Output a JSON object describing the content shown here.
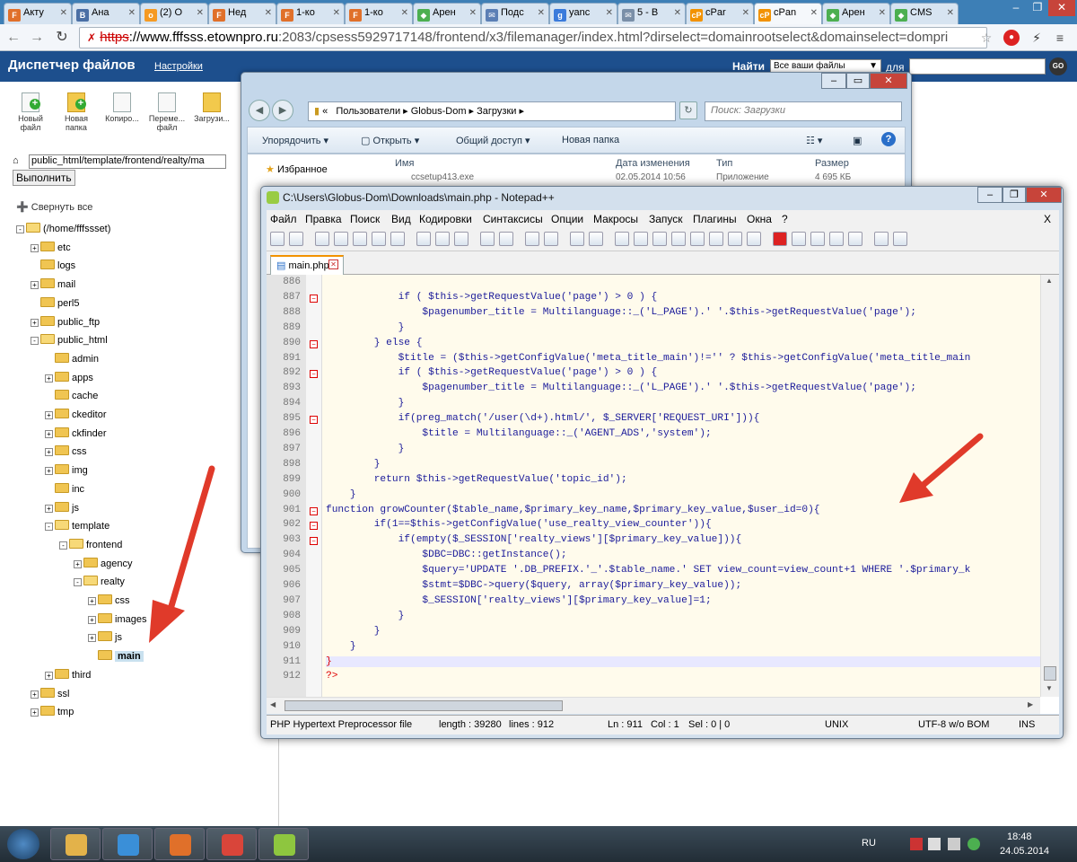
{
  "browser": {
    "tabs": [
      {
        "label": "Акту",
        "fav_text": "F",
        "fav_color": "#e0702a"
      },
      {
        "label": "Ана",
        "fav_text": "B",
        "fav_color": "#4a6fa5"
      },
      {
        "label": "(2) О",
        "fav_text": "о",
        "fav_color": "#f59a23"
      },
      {
        "label": "Нед",
        "fav_text": "F",
        "fav_color": "#e0702a"
      },
      {
        "label": "1-ко",
        "fav_text": "F",
        "fav_color": "#e0702a"
      },
      {
        "label": "1-ко",
        "fav_text": "F",
        "fav_color": "#e0702a"
      },
      {
        "label": "Арен",
        "fav_text": "◆",
        "fav_color": "#4caf50"
      },
      {
        "label": "Подс",
        "fav_text": "✉",
        "fav_color": "#5b7fb5"
      },
      {
        "label": "yanc",
        "fav_text": "g",
        "fav_color": "#3b7bdb"
      },
      {
        "label": "5 - В",
        "fav_text": "✉",
        "fav_color": "#7a8fa8"
      },
      {
        "label": "cPar",
        "fav_text": "cP",
        "fav_color": "#f29200"
      },
      {
        "label": "cPan",
        "fav_text": "cP",
        "fav_color": "#f29200"
      },
      {
        "label": "Арен",
        "fav_text": "◆",
        "fav_color": "#4caf50"
      },
      {
        "label": "CMS",
        "fav_text": "◆",
        "fav_color": "#4caf50"
      }
    ],
    "url_scheme": "https",
    "url_host": "://www.fffsss.etownpro.ru",
    "url_path": ":2083/cpsess5929717148/frontend/x3/filemanager/index.html?dirselect=domainrootselect&domainselect=dompri"
  },
  "cpanel": {
    "title": "Диспетчер файлов",
    "settings_link": "Настройки",
    "find_label": "Найти",
    "find_scope": "Все ваши файлы",
    "for_label": "для",
    "go_label": "GO",
    "tools": [
      {
        "label": "Новый файл",
        "icon": "new-file-icon"
      },
      {
        "label": "Новая папка",
        "icon": "new-folder-icon"
      },
      {
        "label": "Копиро...",
        "icon": "copy-icon"
      },
      {
        "label": "Переме... файл",
        "icon": "move-icon"
      },
      {
        "label": "Загрузи...",
        "icon": "upload-icon"
      }
    ],
    "path_value": "public_html/template/frontend/realty/ma",
    "go_button": "Выполнить",
    "collapse_all": "Свернуть все",
    "tree": [
      {
        "label": "(/home/fffssset)"
      },
      {
        "label": "etc"
      },
      {
        "label": "logs"
      },
      {
        "label": "mail"
      },
      {
        "label": "perl5"
      },
      {
        "label": "public_ftp"
      },
      {
        "label": "public_html"
      },
      {
        "label": "admin"
      },
      {
        "label": "apps"
      },
      {
        "label": "cache"
      },
      {
        "label": "ckeditor"
      },
      {
        "label": "ckfinder"
      },
      {
        "label": "css"
      },
      {
        "label": "img"
      },
      {
        "label": "inc"
      },
      {
        "label": "js"
      },
      {
        "label": "template"
      },
      {
        "label": "frontend"
      },
      {
        "label": "agency"
      },
      {
        "label": "realty"
      },
      {
        "label": "css"
      },
      {
        "label": "images"
      },
      {
        "label": "js"
      },
      {
        "label": "main"
      },
      {
        "label": "third"
      },
      {
        "label": "ssl"
      },
      {
        "label": "tmp"
      }
    ]
  },
  "explorer": {
    "breadcrumb": [
      "«",
      "Пользователи",
      "Globus-Dom",
      "Загрузки"
    ],
    "search_placeholder": "Поиск: Загрузки",
    "commands": [
      "Упорядочить",
      "Открыть",
      "Общий доступ",
      "Новая папка"
    ],
    "favorites": "Избранное",
    "columns": [
      "Имя",
      "Дата изменения",
      "Тип",
      "Размер"
    ],
    "first_row": [
      "ccsetup413.exe",
      "02.05.2014 10:56",
      "Приложение",
      "4 695 КБ"
    ]
  },
  "notepad": {
    "title": "C:\\Users\\Globus-Dom\\Downloads\\main.php - Notepad++",
    "menu": [
      "Файл",
      "Правка",
      "Поиск",
      "Вид",
      "Кодировки",
      "Синтаксисы",
      "Опции",
      "Макросы",
      "Запуск",
      "Плагины",
      "Окна",
      "?"
    ],
    "menu_close": "X",
    "tab_label": "main.php",
    "lines": [
      {
        "n": "886",
        "t": ""
      },
      {
        "n": "887",
        "t": "            if ( $this->getRequestValue('page') > 0 ) {"
      },
      {
        "n": "888",
        "t": "                $pagenumber_title = Multilanguage::_('L_PAGE').' '.$this->getRequestValue('page');"
      },
      {
        "n": "889",
        "t": "            }"
      },
      {
        "n": "890",
        "t": "        } else {"
      },
      {
        "n": "891",
        "t": "            $title = ($this->getConfigValue('meta_title_main')!='' ? $this->getConfigValue('meta_title_main"
      },
      {
        "n": "892",
        "t": "            if ( $this->getRequestValue('page') > 0 ) {"
      },
      {
        "n": "893",
        "t": "                $pagenumber_title = Multilanguage::_('L_PAGE').' '.$this->getRequestValue('page');"
      },
      {
        "n": "894",
        "t": "            }"
      },
      {
        "n": "895",
        "t": "            if(preg_match('/user(\\d+).html/', $_SERVER['REQUEST_URI'])){"
      },
      {
        "n": "896",
        "t": "                $title = Multilanguage::_('AGENT_ADS','system');"
      },
      {
        "n": "897",
        "t": "            }"
      },
      {
        "n": "898",
        "t": "        }"
      },
      {
        "n": "899",
        "t": "        return $this->getRequestValue('topic_id');"
      },
      {
        "n": "900",
        "t": "    }"
      },
      {
        "n": "901",
        "t": "function growCounter($table_name,$primary_key_name,$primary_key_value,$user_id=0){"
      },
      {
        "n": "902",
        "t": "        if(1==$this->getConfigValue('use_realty_view_counter')){"
      },
      {
        "n": "903",
        "t": "            if(empty($_SESSION['realty_views'][$primary_key_value])){"
      },
      {
        "n": "904",
        "t": "                $DBC=DBC::getInstance();"
      },
      {
        "n": "905",
        "t": "                $query='UPDATE '.DB_PREFIX.'_'.$table_name.' SET view_count=view_count+1 WHERE '.$primary_k"
      },
      {
        "n": "906",
        "t": "                $stmt=$DBC->query($query, array($primary_key_value));"
      },
      {
        "n": "907",
        "t": "                $_SESSION['realty_views'][$primary_key_value]=1;"
      },
      {
        "n": "908",
        "t": "            }"
      },
      {
        "n": "909",
        "t": "        }"
      },
      {
        "n": "910",
        "t": "    }"
      },
      {
        "n": "911",
        "t": "}"
      },
      {
        "n": "912",
        "t": "?>"
      }
    ],
    "status": {
      "type": "PHP Hypertext Preprocessor file",
      "length": "length : 39280",
      "lines": "lines : 912",
      "ln": "Ln : 911",
      "col": "Col : 1",
      "sel": "Sel : 0 | 0",
      "eol": "UNIX",
      "enc": "UTF-8 w/o BOM",
      "ins": "INS"
    }
  },
  "taskbar": {
    "lang": "RU",
    "time": "18:48",
    "date": "24.05.2014",
    "apps": [
      {
        "icon": "explorer-icon",
        "color": "#e3b24a"
      },
      {
        "icon": "ie-icon",
        "color": "#3a8fd8"
      },
      {
        "icon": "media-icon",
        "color": "#e0702a"
      },
      {
        "icon": "chrome-icon",
        "color": "#d9453a"
      },
      {
        "icon": "notepadpp-icon",
        "color": "#8ec63f"
      }
    ]
  }
}
